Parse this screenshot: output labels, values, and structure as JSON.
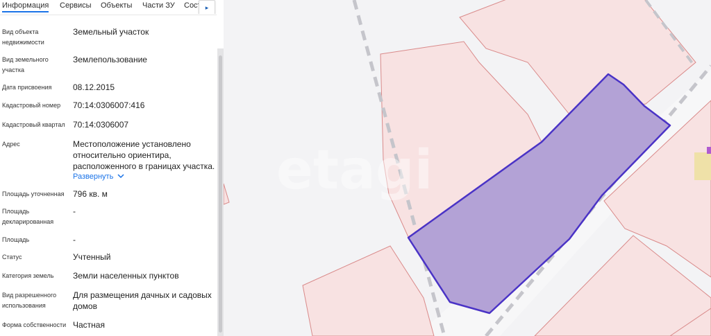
{
  "tabs": [
    "Информация",
    "Сервисы",
    "Объекты",
    "Части ЗУ",
    "Соста"
  ],
  "tab_next": "▸",
  "fields": [
    {
      "label": "Вид объекта недвижимости",
      "value": "Земельный участок"
    },
    {
      "label": "Вид земельного участка",
      "value": "Землепользование"
    },
    {
      "label": "Дата присвоения",
      "value": "08.12.2015"
    },
    {
      "label": "Кадастровый номер",
      "value": "70:14:0306007:416"
    },
    {
      "label": "Кадастровый квартал",
      "value": "70:14:0306007"
    },
    {
      "label": "Адрес",
      "value": "Местоположение установлено относительно ориентира, расположенного в границах участка."
    },
    {
      "label": "Площадь уточненная",
      "value": "796 кв. м"
    },
    {
      "label": "Площадь декларированная",
      "value": "-"
    },
    {
      "label": "Площадь",
      "value": "-"
    },
    {
      "label": "Статус",
      "value": "Учтенный"
    },
    {
      "label": "Категория земель",
      "value": "Земли населенных пунктов"
    },
    {
      "label": "Вид разрешенного использования",
      "value": "Для размещения дачных и садовых домов"
    },
    {
      "label": "Форма собственности",
      "value": "Частная"
    }
  ],
  "expand_link": "Развернуть",
  "watermark": "etagi",
  "colors": {
    "parcel_fill": "#f8e2e2",
    "parcel_border": "#d98a8a",
    "selected_fill": "#b3a2d6",
    "selected_border": "#4a33c6",
    "link": "#1a73e8",
    "road_dash": "#c5c5cb"
  }
}
